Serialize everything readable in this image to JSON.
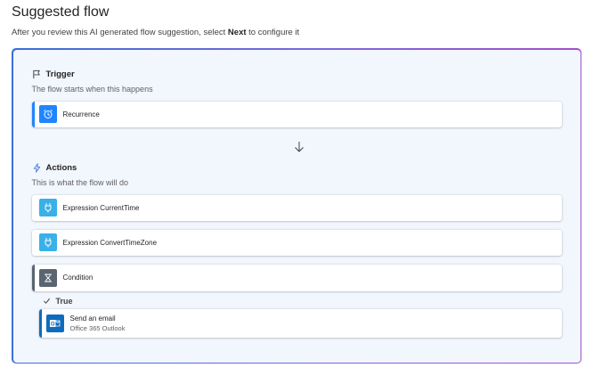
{
  "header": {
    "title": "Suggested flow",
    "subtitle_prefix": "After you review this AI generated flow suggestion, select ",
    "subtitle_bold": "Next",
    "subtitle_suffix": " to configure it"
  },
  "trigger": {
    "heading": "Trigger",
    "description": "The flow starts when this happens",
    "card": {
      "label": "Recurrence",
      "icon": "alarm-clock-icon",
      "color": "#1f85ff"
    }
  },
  "actions": {
    "heading": "Actions",
    "description": "This is what the flow will do",
    "cards": [
      {
        "label": "Expression CurrentTime",
        "icon": "plug-icon",
        "color": "#3ab0e8"
      },
      {
        "label": "Expression ConvertTimeZone",
        "icon": "plug-icon",
        "color": "#3ab0e8"
      },
      {
        "label": "Condition",
        "icon": "condition-icon",
        "color": "#5a6571"
      }
    ]
  },
  "branch": {
    "label": "True",
    "card": {
      "title": "Send an email",
      "subtitle": "Office 365 Outlook",
      "icon": "outlook-icon",
      "color": "#0f6cbd"
    }
  },
  "colors": {
    "trigger_accent": "#1f85ff",
    "expression_accent": "#3ab0e8",
    "condition_accent": "#5a6571",
    "email_accent": "#0f6cbd"
  }
}
